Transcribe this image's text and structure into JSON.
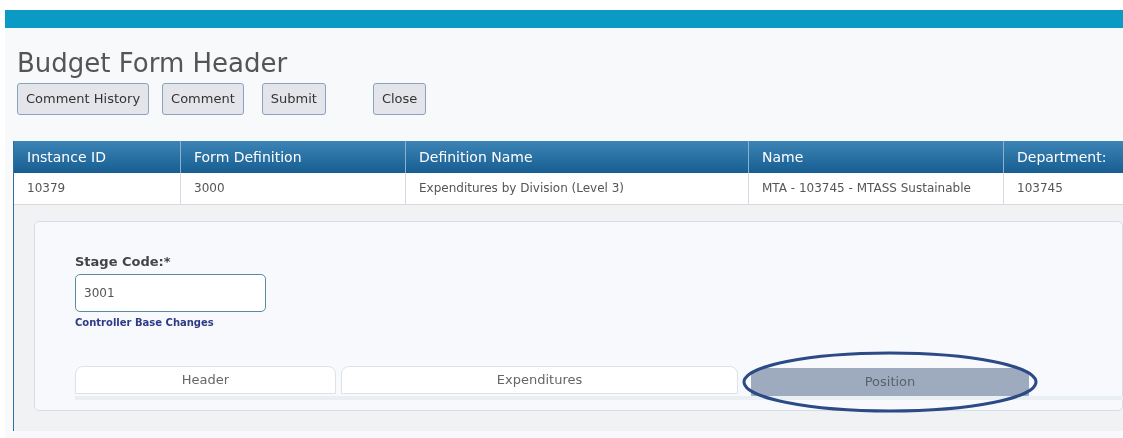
{
  "page": {
    "title": "Budget Form Header"
  },
  "buttons": [
    "Comment History",
    "Comment",
    "Submit",
    "Close"
  ],
  "table": {
    "columns": [
      "Instance ID",
      "Form Definition",
      "Definition Name",
      "Name",
      "Department:"
    ],
    "rows": [
      [
        "10379",
        "3000",
        "Expenditures by Division (Level 3)",
        "MTA - 103745 - MTASS Sustainable",
        "103745"
      ]
    ]
  },
  "stage_code": {
    "label": "Stage Code:*",
    "value": "3001",
    "description": "Controller Base Changes"
  },
  "tabs": [
    {
      "label": "Header",
      "selected": false
    },
    {
      "label": "Expenditures",
      "selected": false
    },
    {
      "label": "Position",
      "selected": true,
      "circled": true
    }
  ]
}
